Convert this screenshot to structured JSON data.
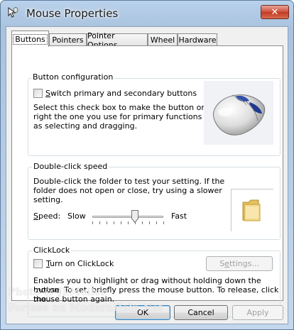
{
  "window": {
    "title": "Mouse Properties",
    "close_glyph": "✕"
  },
  "tabs": [
    {
      "label": "Buttons",
      "active": true
    },
    {
      "label": "Pointers"
    },
    {
      "label": "Pointer Options"
    },
    {
      "label": "Wheel"
    },
    {
      "label": "Hardware"
    }
  ],
  "button_config": {
    "title": "Button configuration",
    "checkbox_label_prefix": "",
    "checkbox_label_underline": "S",
    "checkbox_label_rest": "witch primary and secondary buttons",
    "checked": false,
    "description_lines": [
      "Select this check box to make the button on the",
      "right the one you use for primary functions such",
      "as selecting and dragging."
    ]
  },
  "double_click": {
    "title": "Double-click speed",
    "description_lines": [
      "Double-click the folder to test your setting. If the",
      "folder does not open or close, try using a slower",
      "setting."
    ],
    "speed_label_underline": "S",
    "speed_label_rest": "peed:",
    "slow_label": "Slow",
    "fast_label": "Fast",
    "slider_value": 0.6
  },
  "clicklock": {
    "title": "ClickLock",
    "checkbox_label_underline": "T",
    "checkbox_label_rest": "urn on ClickLock",
    "checked": false,
    "settings_label_prefix": "S",
    "settings_label_underline": "e",
    "settings_label_rest": "ttings...",
    "description_lines": [
      "Enables you to highlight or drag without holding down the mouse",
      "button. To set, briefly press the mouse button. To release, click the",
      "mouse button again."
    ]
  },
  "buttons": {
    "ok": "OK",
    "cancel": "Cancel",
    "apply": "Apply"
  },
  "watermark": {
    "line1": "Photo @ JEMeller",
    "line2": "For use on ModernHelp.Net"
  },
  "icons": {
    "app": "mouse-cursor-icon",
    "close": "close-icon",
    "folder": "folder-icon",
    "mouse": "mouse-illustration-icon"
  }
}
